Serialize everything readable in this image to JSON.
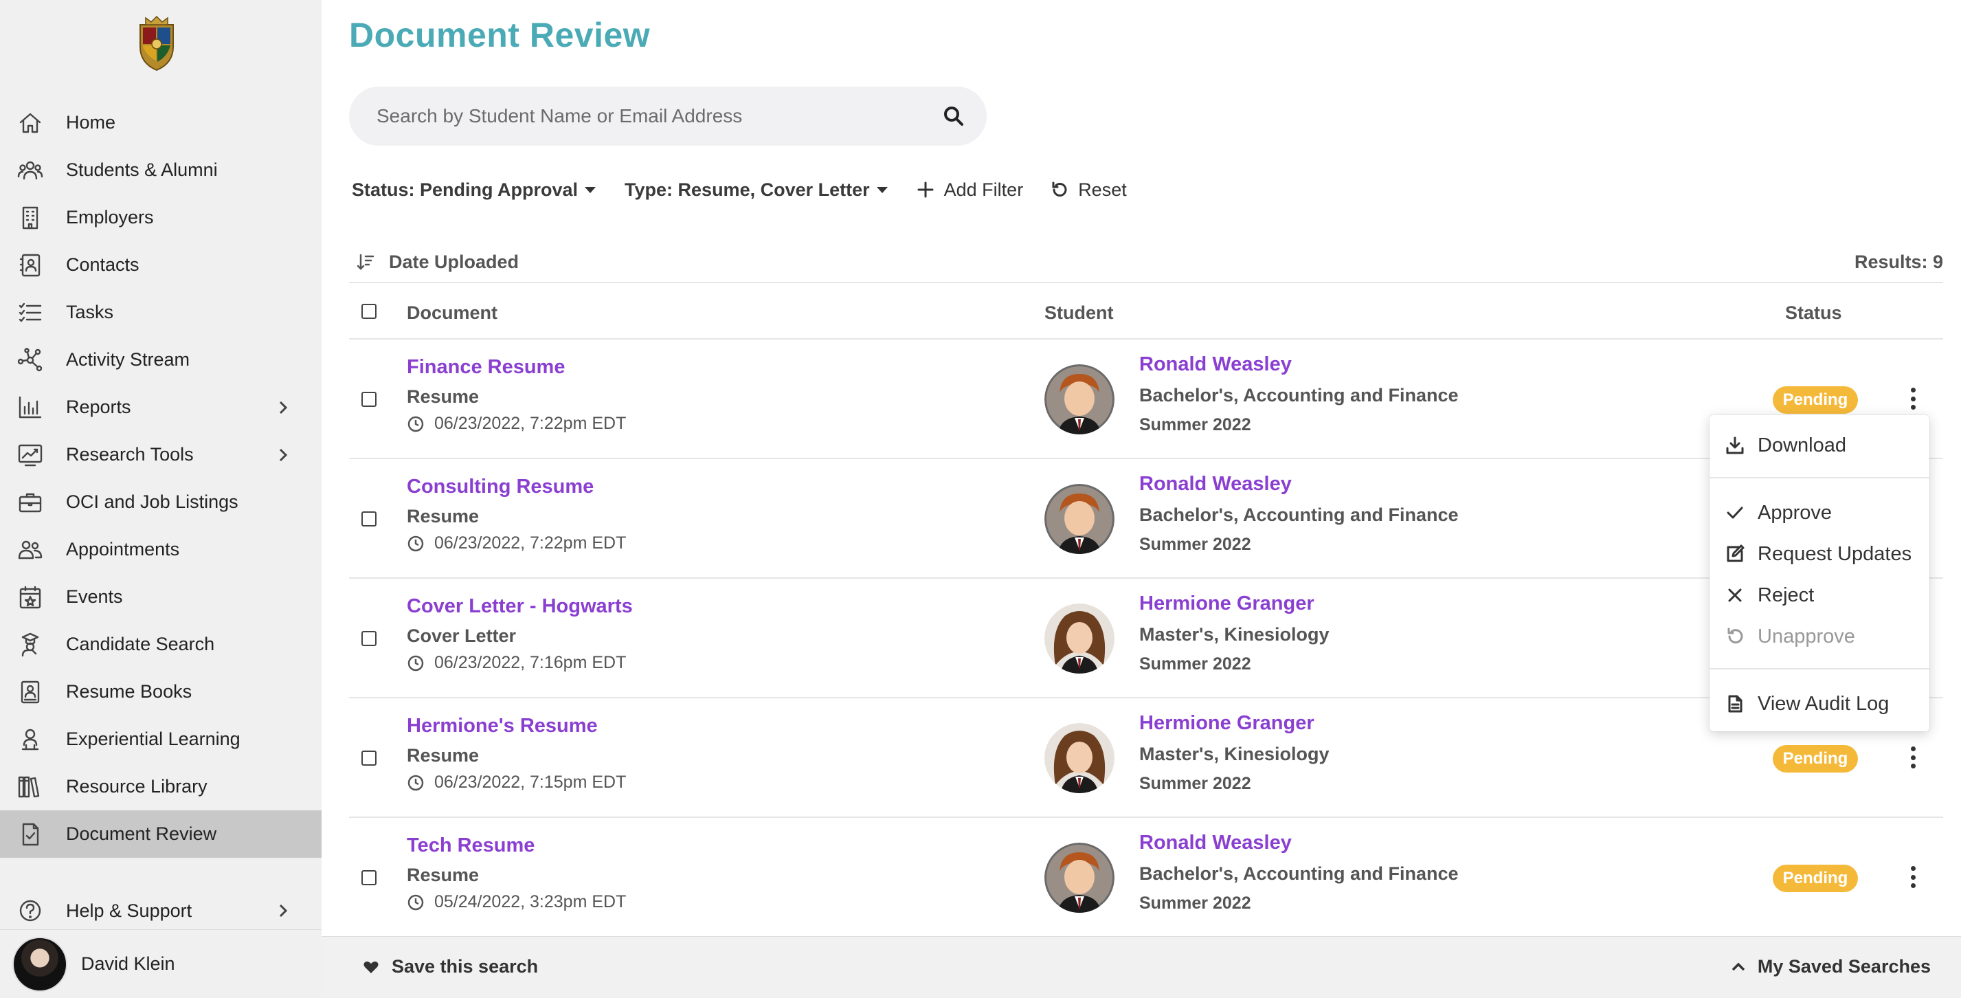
{
  "sidebar": {
    "logo_icon": "crest-logo",
    "items": [
      {
        "label": "Home",
        "icon": "home-icon"
      },
      {
        "label": "Students & Alumni",
        "icon": "people-icon"
      },
      {
        "label": "Employers",
        "icon": "building-icon"
      },
      {
        "label": "Contacts",
        "icon": "contact-card-icon"
      },
      {
        "label": "Tasks",
        "icon": "task-list-icon"
      },
      {
        "label": "Activity Stream",
        "icon": "network-icon"
      },
      {
        "label": "Reports",
        "icon": "bar-chart-icon",
        "has_chevron": true
      },
      {
        "label": "Research Tools",
        "icon": "trend-chart-icon",
        "has_chevron": true
      },
      {
        "label": "OCI and Job Listings",
        "icon": "briefcase-icon"
      },
      {
        "label": "Appointments",
        "icon": "people-pair-icon"
      },
      {
        "label": "Events",
        "icon": "calendar-star-icon"
      },
      {
        "label": "Candidate Search",
        "icon": "graduate-search-icon"
      },
      {
        "label": "Resume Books",
        "icon": "resume-book-icon"
      },
      {
        "label": "Experiential Learning",
        "icon": "learner-icon"
      },
      {
        "label": "Resource Library",
        "icon": "library-icon"
      },
      {
        "label": "Document Review",
        "icon": "document-check-icon",
        "active": true
      },
      {
        "label": "Help & Support",
        "icon": "help-icon",
        "has_chevron": true
      }
    ],
    "user": {
      "name": "David Klein"
    }
  },
  "header": {
    "title": "Document Review"
  },
  "search": {
    "placeholder": "Search by Student Name or Email Address",
    "value": ""
  },
  "filters": {
    "status": "Status: Pending Approval",
    "type": "Type: Resume, Cover Letter",
    "add_filter": "Add Filter",
    "reset": "Reset"
  },
  "sort": {
    "label": "Date Uploaded",
    "results": "Results: 9"
  },
  "table": {
    "columns": {
      "document": "Document",
      "student": "Student",
      "status": "Status"
    },
    "rows": [
      {
        "title": "Finance Resume",
        "type": "Resume",
        "date": "06/23/2022, 7:22pm EDT",
        "student": "Ronald Weasley",
        "degree": "Bachelor's, Accounting and Finance",
        "term": "Summer 2022",
        "status": "Pending"
      },
      {
        "title": "Consulting Resume",
        "type": "Resume",
        "date": "06/23/2022, 7:22pm EDT",
        "student": "Ronald Weasley",
        "degree": "Bachelor's, Accounting and Finance",
        "term": "Summer 2022",
        "status": ""
      },
      {
        "title": "Cover Letter - Hogwarts",
        "type": "Cover Letter",
        "date": "06/23/2022, 7:16pm EDT",
        "student": "Hermione Granger",
        "degree": "Master's, Kinesiology",
        "term": "Summer 2022",
        "status": ""
      },
      {
        "title": "Hermione's Resume",
        "type": "Resume",
        "date": "06/23/2022, 7:15pm EDT",
        "student": "Hermione Granger",
        "degree": "Master's, Kinesiology",
        "term": "Summer 2022",
        "status": "Pending"
      },
      {
        "title": "Tech Resume",
        "type": "Resume",
        "date": "05/24/2022, 3:23pm EDT",
        "student": "Ronald Weasley",
        "degree": "Bachelor's, Accounting and Finance",
        "term": "Summer 2022",
        "status": "Pending"
      }
    ]
  },
  "menu": {
    "items": [
      {
        "label": "Download",
        "icon": "download-icon"
      },
      {
        "label": "Approve",
        "icon": "check-icon"
      },
      {
        "label": "Request Updates",
        "icon": "edit-icon"
      },
      {
        "label": "Reject",
        "icon": "close-icon"
      },
      {
        "label": "Unapprove",
        "icon": "undo-icon",
        "disabled": true
      },
      {
        "label": "View Audit Log",
        "icon": "document-icon"
      }
    ]
  },
  "footer": {
    "save_search": "Save this search",
    "saved_searches": "My Saved Searches"
  },
  "colors": {
    "title": "#4aaab5",
    "link": "#8a3fd1",
    "pending": "#f5b93a",
    "sidebar_bg": "#f0f0f0",
    "sidebar_active": "#c8c8c8"
  }
}
